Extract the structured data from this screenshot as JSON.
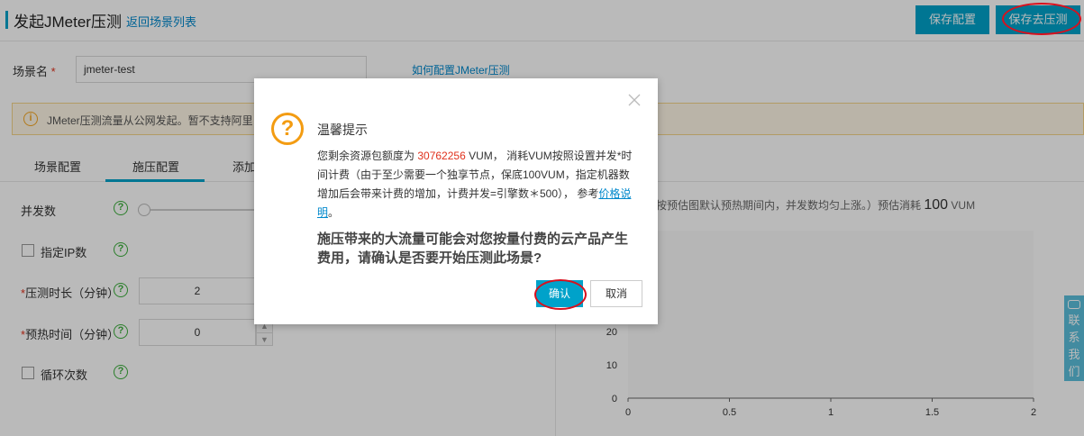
{
  "header": {
    "title": "发起JMeter压测",
    "back_link": "返回场景列表",
    "save_button": "保存配置",
    "save_test_button": "保存去压测"
  },
  "form": {
    "scene_label": "场景名",
    "required_mark": "*",
    "scene_value": "jmeter-test",
    "help_link": "如何配置JMeter压测"
  },
  "notice": {
    "text": "JMeter压测流量从公网发起。暂不支持阿里"
  },
  "tabs": [
    {
      "label": "场景配置"
    },
    {
      "label": "施压配置"
    },
    {
      "label": "添加"
    }
  ],
  "settings": {
    "concurrency_label": "并发数",
    "ip_label": "指定IP数",
    "duration_label": "压测时长（分钟）",
    "duration_value": "2",
    "warmup_label": "预热时间（分钟）",
    "warmup_value": "0",
    "loop_label": "循环次数"
  },
  "right_panel": {
    "desc_prefix": "按预估图默认预热期间内，并发数均匀上涨。）预估消耗",
    "vum_value": "100",
    "vum_unit": "VUM"
  },
  "side": {
    "contact": "联系我们"
  },
  "dialog": {
    "title": "温馨提示",
    "body_1": "您剩余资源包额度为",
    "balance": "30762256",
    "body_2": "VUM，  消耗VUM按照设置并发*时间计费（由于至少需要一个独享节点，保底100VUM，指定机器数增加后会带来计费的增加，计费并发=引擎数＊500），  参考",
    "price_link": "价格说明",
    "body_end": "。",
    "warning": "施压带来的大流量可能会对您按量付费的云产品产生费用，请确认是否要开始压测此场景?",
    "ok": "确认",
    "cancel": "取消"
  },
  "chart_data": {
    "type": "line",
    "x_ticks": [
      "0",
      "0.5",
      "1",
      "1.5",
      "2"
    ],
    "y_ticks": [
      "0",
      "10",
      "20"
    ],
    "xlim": [
      0,
      2
    ],
    "ylim": [
      0,
      20
    ],
    "grid": false
  },
  "colors": {
    "accent": "#00a2ca",
    "highlight_red": "#e0311c",
    "annotation_red": "#d9101d"
  }
}
